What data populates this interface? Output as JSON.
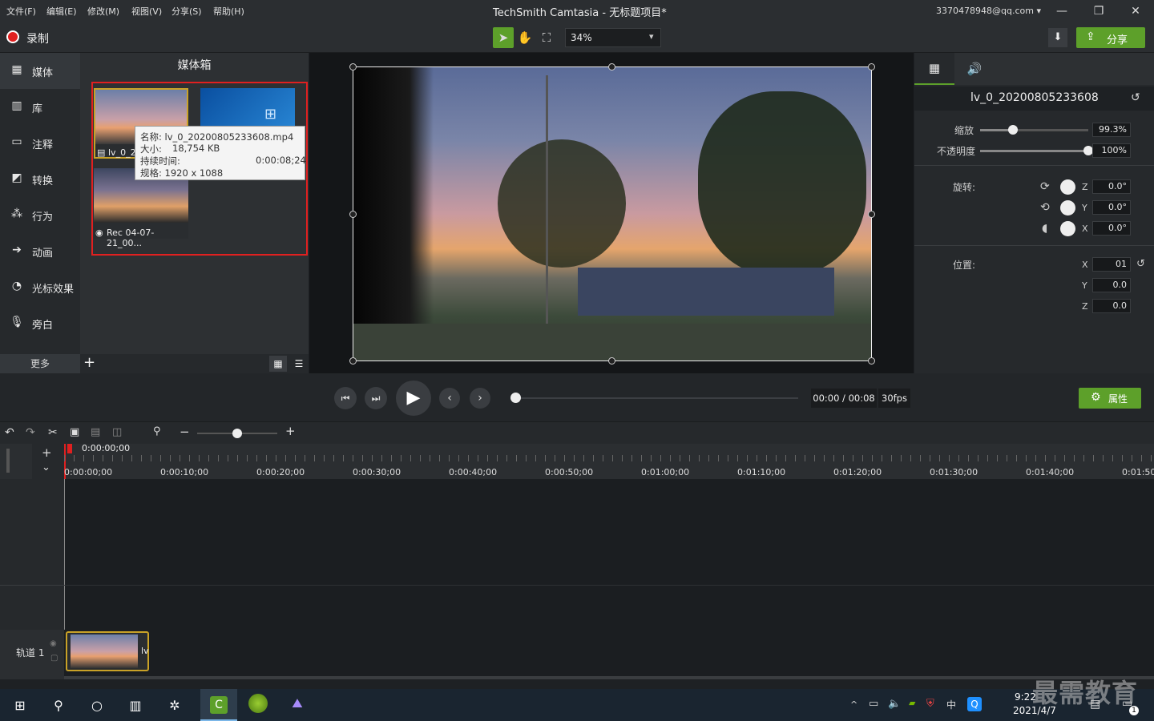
{
  "menu": [
    "文件(F)",
    "编辑(E)",
    "修改(M)",
    "视图(V)",
    "分享(S)",
    "帮助(H)"
  ],
  "window_title": "TechSmith Camtasia - 无标题项目*",
  "account": "3370478948@qq.com",
  "record_label": "录制",
  "zoom_value": "34%",
  "share_label": "分享",
  "sidebar": {
    "items": [
      {
        "label": "媒体",
        "icon": "film-icon"
      },
      {
        "label": "库",
        "icon": "library-icon"
      },
      {
        "label": "注释",
        "icon": "annotation-icon"
      },
      {
        "label": "转换",
        "icon": "transition-icon"
      },
      {
        "label": "行为",
        "icon": "behavior-icon"
      },
      {
        "label": "动画",
        "icon": "animation-icon"
      },
      {
        "label": "光标效果",
        "icon": "cursor-icon"
      },
      {
        "label": "旁白",
        "icon": "microphone-icon"
      }
    ],
    "more_label": "更多"
  },
  "media_bin": {
    "title": "媒体箱",
    "items": [
      {
        "label": "lv_0_2"
      },
      {
        "label": ""
      },
      {
        "label": "Rec 04-07-21_00..."
      }
    ],
    "tooltip": {
      "name": "名称: lv_0_20200805233608.mp4",
      "size_label": "大小:",
      "size_value": "18,754 KB",
      "duration_label": "持续时间:",
      "duration_value": "0:00:08;24",
      "spec": "规格: 1920 x 1088"
    }
  },
  "properties": {
    "clip_name": "lv_0_20200805233608",
    "scale_label": "缩放",
    "scale_value": "99.3%",
    "scale_level": 0.3,
    "opacity_label": "不透明度",
    "opacity_value": "100%",
    "opacity_level": 1.0,
    "rotation_label": "旋转:",
    "rot_z": "0.0°",
    "rot_y": "0.0°",
    "rot_x": "0.0°",
    "position_label": "位置:",
    "pos_x": "01",
    "pos_y": "0.0",
    "pos_z": "0.0",
    "axis_z": "Z",
    "axis_y": "Y",
    "axis_x": "X"
  },
  "playback": {
    "time": "00:00 / 00:08",
    "fps": "30fps",
    "properties_label": "属性"
  },
  "timeline": {
    "playhead": "0:00:00;00",
    "ticks": [
      "0:00:00;00",
      "0:00:10;00",
      "0:00:20;00",
      "0:00:30;00",
      "0:00:40;00",
      "0:00:50;00",
      "0:01:00;00",
      "0:01:10;00",
      "0:01:20;00",
      "0:01:30;00",
      "0:01:40;00",
      "0:01:50;"
    ],
    "track_label": "轨道 1",
    "clip_label": "lv"
  },
  "taskbar": {
    "time": "9:22",
    "date": "2021/4/7",
    "ime": "中",
    "notif_count": "1"
  },
  "watermark": "最需教育",
  "colors": {
    "accent_green": "#5da02a",
    "selection_red": "#e02020"
  }
}
